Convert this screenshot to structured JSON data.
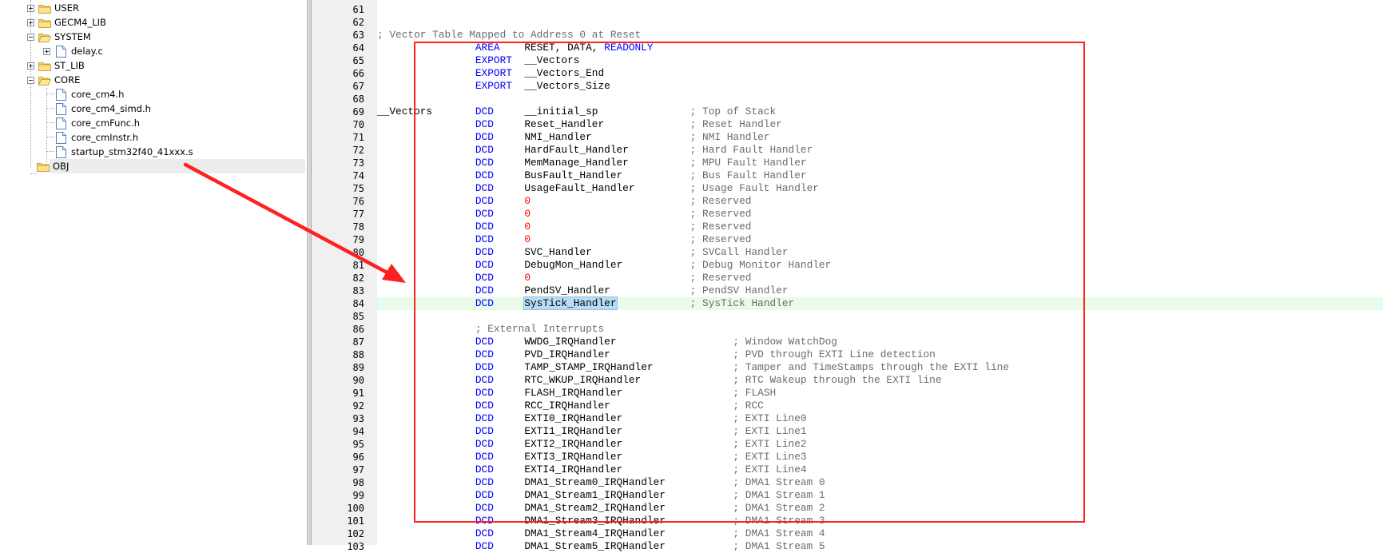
{
  "tree": {
    "items": [
      {
        "label": "USER",
        "kind": "folder",
        "expander": "plus"
      },
      {
        "label": "GECM4_LIB",
        "kind": "folder",
        "expander": "plus"
      },
      {
        "label": "SYSTEM",
        "kind": "folder-open",
        "expander": "minus"
      },
      {
        "label": "delay.c",
        "kind": "file",
        "expander": "plus"
      },
      {
        "label": "ST_LIB",
        "kind": "folder",
        "expander": "plus"
      },
      {
        "label": "CORE",
        "kind": "folder-open",
        "expander": "minus"
      },
      {
        "label": "core_cm4.h",
        "kind": "file"
      },
      {
        "label": "core_cm4_simd.h",
        "kind": "file"
      },
      {
        "label": "core_cmFunc.h",
        "kind": "file"
      },
      {
        "label": "core_cmInstr.h",
        "kind": "file"
      },
      {
        "label": "startup_stm32f40_41xxx.s",
        "kind": "file",
        "selected": true
      },
      {
        "label": "OBJ",
        "kind": "folder"
      }
    ]
  },
  "editor": {
    "current_line": 84,
    "lines": [
      {
        "n": "61",
        "parts": []
      },
      {
        "n": "62",
        "parts": []
      },
      {
        "n": "63",
        "parts": [
          {
            "t": "; Vector Table Mapped to Address 0 at Reset",
            "c": "cm"
          }
        ]
      },
      {
        "n": "64",
        "parts": [
          {
            "t": "                AREA    ",
            "c": "kw"
          },
          {
            "t": "RESET, DATA, ",
            "c": ""
          },
          {
            "t": "READONLY",
            "c": "kw"
          }
        ]
      },
      {
        "n": "65",
        "parts": [
          {
            "t": "                EXPORT  ",
            "c": "kw"
          },
          {
            "t": "__Vectors",
            "c": ""
          }
        ]
      },
      {
        "n": "66",
        "parts": [
          {
            "t": "                EXPORT  ",
            "c": "kw"
          },
          {
            "t": "__Vectors_End",
            "c": ""
          }
        ]
      },
      {
        "n": "67",
        "parts": [
          {
            "t": "                EXPORT  ",
            "c": "kw"
          },
          {
            "t": "__Vectors_Size",
            "c": ""
          }
        ]
      },
      {
        "n": "68",
        "parts": []
      },
      {
        "n": "69",
        "parts": [
          {
            "t": "__Vectors       ",
            "c": ""
          },
          {
            "t": "DCD     ",
            "c": "kw"
          },
          {
            "t": "__initial_sp               ",
            "c": ""
          },
          {
            "t": "; Top of Stack",
            "c": "cm"
          }
        ]
      },
      {
        "n": "70",
        "parts": [
          {
            "t": "                ",
            "c": ""
          },
          {
            "t": "DCD     ",
            "c": "kw"
          },
          {
            "t": "Reset_Handler              ",
            "c": ""
          },
          {
            "t": "; Reset Handler",
            "c": "cm"
          }
        ]
      },
      {
        "n": "71",
        "parts": [
          {
            "t": "                ",
            "c": ""
          },
          {
            "t": "DCD     ",
            "c": "kw"
          },
          {
            "t": "NMI_Handler                ",
            "c": ""
          },
          {
            "t": "; NMI Handler",
            "c": "cm"
          }
        ]
      },
      {
        "n": "72",
        "parts": [
          {
            "t": "                ",
            "c": ""
          },
          {
            "t": "DCD     ",
            "c": "kw"
          },
          {
            "t": "HardFault_Handler          ",
            "c": ""
          },
          {
            "t": "; Hard Fault Handler",
            "c": "cm"
          }
        ]
      },
      {
        "n": "73",
        "parts": [
          {
            "t": "                ",
            "c": ""
          },
          {
            "t": "DCD     ",
            "c": "kw"
          },
          {
            "t": "MemManage_Handler          ",
            "c": ""
          },
          {
            "t": "; MPU Fault Handler",
            "c": "cm"
          }
        ]
      },
      {
        "n": "74",
        "parts": [
          {
            "t": "                ",
            "c": ""
          },
          {
            "t": "DCD     ",
            "c": "kw"
          },
          {
            "t": "BusFault_Handler           ",
            "c": ""
          },
          {
            "t": "; Bus Fault Handler",
            "c": "cm"
          }
        ]
      },
      {
        "n": "75",
        "parts": [
          {
            "t": "                ",
            "c": ""
          },
          {
            "t": "DCD     ",
            "c": "kw"
          },
          {
            "t": "UsageFault_Handler         ",
            "c": ""
          },
          {
            "t": "; Usage Fault Handler",
            "c": "cm"
          }
        ]
      },
      {
        "n": "76",
        "parts": [
          {
            "t": "                ",
            "c": ""
          },
          {
            "t": "DCD     ",
            "c": "kw"
          },
          {
            "t": "0                          ",
            "c": "num"
          },
          {
            "t": "; Reserved",
            "c": "cm"
          }
        ]
      },
      {
        "n": "77",
        "parts": [
          {
            "t": "                ",
            "c": ""
          },
          {
            "t": "DCD     ",
            "c": "kw"
          },
          {
            "t": "0                          ",
            "c": "num"
          },
          {
            "t": "; Reserved",
            "c": "cm"
          }
        ]
      },
      {
        "n": "78",
        "parts": [
          {
            "t": "                ",
            "c": ""
          },
          {
            "t": "DCD     ",
            "c": "kw"
          },
          {
            "t": "0                          ",
            "c": "num"
          },
          {
            "t": "; Reserved",
            "c": "cm"
          }
        ]
      },
      {
        "n": "79",
        "parts": [
          {
            "t": "                ",
            "c": ""
          },
          {
            "t": "DCD     ",
            "c": "kw"
          },
          {
            "t": "0                          ",
            "c": "num"
          },
          {
            "t": "; Reserved",
            "c": "cm"
          }
        ]
      },
      {
        "n": "80",
        "parts": [
          {
            "t": "                ",
            "c": ""
          },
          {
            "t": "DCD     ",
            "c": "kw"
          },
          {
            "t": "SVC_Handler                ",
            "c": ""
          },
          {
            "t": "; SVCall Handler",
            "c": "cm"
          }
        ]
      },
      {
        "n": "81",
        "parts": [
          {
            "t": "                ",
            "c": ""
          },
          {
            "t": "DCD     ",
            "c": "kw"
          },
          {
            "t": "DebugMon_Handler           ",
            "c": ""
          },
          {
            "t": "; Debug Monitor Handler",
            "c": "cm"
          }
        ]
      },
      {
        "n": "82",
        "parts": [
          {
            "t": "                ",
            "c": ""
          },
          {
            "t": "DCD     ",
            "c": "kw"
          },
          {
            "t": "0                          ",
            "c": "num"
          },
          {
            "t": "; Reserved",
            "c": "cm"
          }
        ]
      },
      {
        "n": "83",
        "parts": [
          {
            "t": "                ",
            "c": ""
          },
          {
            "t": "DCD     ",
            "c": "kw"
          },
          {
            "t": "PendSV_Handler             ",
            "c": ""
          },
          {
            "t": "; PendSV Handler",
            "c": "cm"
          }
        ]
      },
      {
        "n": "84",
        "parts": [
          {
            "t": "                ",
            "c": ""
          },
          {
            "t": "DCD     ",
            "c": "kw"
          },
          {
            "t": "SysTick_Handler",
            "c": "hl"
          },
          {
            "t": "            ",
            "c": ""
          },
          {
            "t": "; SysTick Handler",
            "c": "cm"
          }
        ]
      },
      {
        "n": "85",
        "parts": []
      },
      {
        "n": "86",
        "parts": [
          {
            "t": "                ",
            "c": ""
          },
          {
            "t": "; External Interrupts",
            "c": "cm"
          }
        ]
      },
      {
        "n": "87",
        "parts": [
          {
            "t": "                ",
            "c": ""
          },
          {
            "t": "DCD     ",
            "c": "kw"
          },
          {
            "t": "WWDG_IRQHandler                   ",
            "c": ""
          },
          {
            "t": "; Window WatchDog",
            "c": "cm"
          }
        ]
      },
      {
        "n": "88",
        "parts": [
          {
            "t": "                ",
            "c": ""
          },
          {
            "t": "DCD     ",
            "c": "kw"
          },
          {
            "t": "PVD_IRQHandler                    ",
            "c": ""
          },
          {
            "t": "; PVD through EXTI Line detection",
            "c": "cm"
          }
        ]
      },
      {
        "n": "89",
        "parts": [
          {
            "t": "                ",
            "c": ""
          },
          {
            "t": "DCD     ",
            "c": "kw"
          },
          {
            "t": "TAMP_STAMP_IRQHandler             ",
            "c": ""
          },
          {
            "t": "; Tamper and TimeStamps through the EXTI line",
            "c": "cm"
          }
        ]
      },
      {
        "n": "90",
        "parts": [
          {
            "t": "                ",
            "c": ""
          },
          {
            "t": "DCD     ",
            "c": "kw"
          },
          {
            "t": "RTC_WKUP_IRQHandler               ",
            "c": ""
          },
          {
            "t": "; RTC Wakeup through the EXTI line",
            "c": "cm"
          }
        ]
      },
      {
        "n": "91",
        "parts": [
          {
            "t": "                ",
            "c": ""
          },
          {
            "t": "DCD     ",
            "c": "kw"
          },
          {
            "t": "FLASH_IRQHandler                  ",
            "c": ""
          },
          {
            "t": "; FLASH",
            "c": "cm"
          }
        ]
      },
      {
        "n": "92",
        "parts": [
          {
            "t": "                ",
            "c": ""
          },
          {
            "t": "DCD     ",
            "c": "kw"
          },
          {
            "t": "RCC_IRQHandler                    ",
            "c": ""
          },
          {
            "t": "; RCC",
            "c": "cm"
          }
        ]
      },
      {
        "n": "93",
        "parts": [
          {
            "t": "                ",
            "c": ""
          },
          {
            "t": "DCD     ",
            "c": "kw"
          },
          {
            "t": "EXTI0_IRQHandler                  ",
            "c": ""
          },
          {
            "t": "; EXTI Line0",
            "c": "cm"
          }
        ]
      },
      {
        "n": "94",
        "parts": [
          {
            "t": "                ",
            "c": ""
          },
          {
            "t": "DCD     ",
            "c": "kw"
          },
          {
            "t": "EXTI1_IRQHandler                  ",
            "c": ""
          },
          {
            "t": "; EXTI Line1",
            "c": "cm"
          }
        ]
      },
      {
        "n": "95",
        "parts": [
          {
            "t": "                ",
            "c": ""
          },
          {
            "t": "DCD     ",
            "c": "kw"
          },
          {
            "t": "EXTI2_IRQHandler                  ",
            "c": ""
          },
          {
            "t": "; EXTI Line2",
            "c": "cm"
          }
        ]
      },
      {
        "n": "96",
        "parts": [
          {
            "t": "                ",
            "c": ""
          },
          {
            "t": "DCD     ",
            "c": "kw"
          },
          {
            "t": "EXTI3_IRQHandler                  ",
            "c": ""
          },
          {
            "t": "; EXTI Line3",
            "c": "cm"
          }
        ]
      },
      {
        "n": "97",
        "parts": [
          {
            "t": "                ",
            "c": ""
          },
          {
            "t": "DCD     ",
            "c": "kw"
          },
          {
            "t": "EXTI4_IRQHandler                  ",
            "c": ""
          },
          {
            "t": "; EXTI Line4",
            "c": "cm"
          }
        ]
      },
      {
        "n": "98",
        "parts": [
          {
            "t": "                ",
            "c": ""
          },
          {
            "t": "DCD     ",
            "c": "kw"
          },
          {
            "t": "DMA1_Stream0_IRQHandler           ",
            "c": ""
          },
          {
            "t": "; DMA1 Stream 0",
            "c": "cm"
          }
        ]
      },
      {
        "n": "99",
        "parts": [
          {
            "t": "                ",
            "c": ""
          },
          {
            "t": "DCD     ",
            "c": "kw"
          },
          {
            "t": "DMA1_Stream1_IRQHandler           ",
            "c": ""
          },
          {
            "t": "; DMA1 Stream 1",
            "c": "cm"
          }
        ]
      },
      {
        "n": "100",
        "parts": [
          {
            "t": "                ",
            "c": ""
          },
          {
            "t": "DCD     ",
            "c": "kw"
          },
          {
            "t": "DMA1_Stream2_IRQHandler           ",
            "c": ""
          },
          {
            "t": "; DMA1 Stream 2",
            "c": "cm"
          }
        ]
      },
      {
        "n": "101",
        "parts": [
          {
            "t": "                ",
            "c": ""
          },
          {
            "t": "DCD     ",
            "c": "kw"
          },
          {
            "t": "DMA1_Stream3_IRQHandler           ",
            "c": ""
          },
          {
            "t": "; DMA1 Stream 3",
            "c": "cm"
          }
        ]
      },
      {
        "n": "102",
        "parts": [
          {
            "t": "                ",
            "c": ""
          },
          {
            "t": "DCD     ",
            "c": "kw"
          },
          {
            "t": "DMA1_Stream4_IRQHandler           ",
            "c": ""
          },
          {
            "t": "; DMA1 Stream 4",
            "c": "cm"
          }
        ]
      },
      {
        "n": "103",
        "parts": [
          {
            "t": "                ",
            "c": ""
          },
          {
            "t": "DCD     ",
            "c": "kw"
          },
          {
            "t": "DMA1_Stream5_IRQHandler           ",
            "c": ""
          },
          {
            "t": "; DMA1 Stream 5",
            "c": "cm"
          }
        ]
      }
    ]
  },
  "colors": {
    "keyword": "#0000ff",
    "number": "#ff0000",
    "comment": "#6b6b6b",
    "current_line_bg": "#e9fbe9",
    "selection_bg": "#b9dcf5",
    "annotation_red": "#ff2020"
  },
  "annotations": {
    "box": "red-rectangle",
    "arrow": "red-arrow"
  }
}
